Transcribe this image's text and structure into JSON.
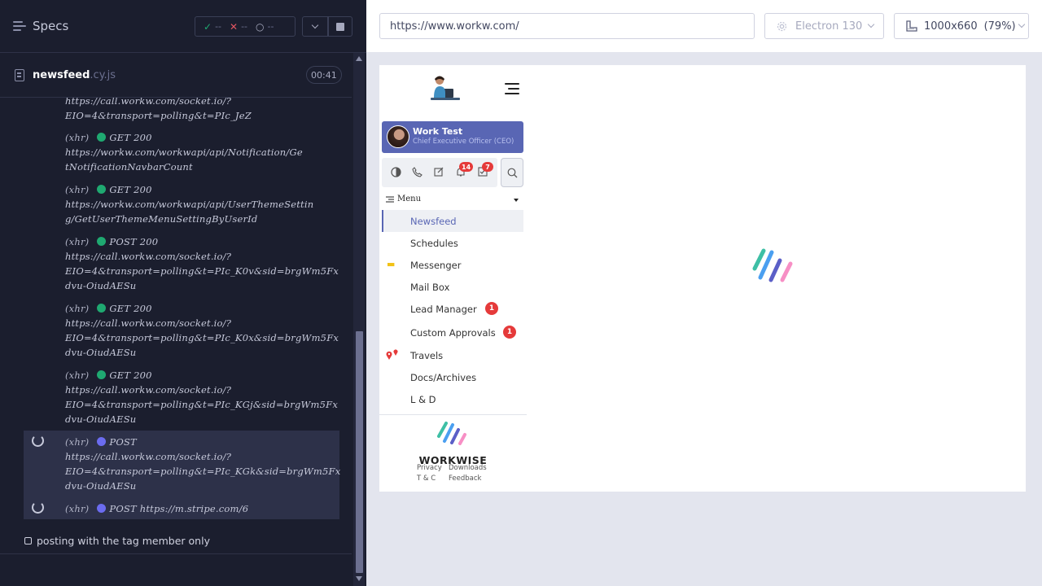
{
  "runner": {
    "header": {
      "title": "Specs"
    },
    "stats": {
      "passed": "--",
      "failed": "--",
      "pending": "--"
    },
    "spec_file": {
      "name": "newsfeed",
      "ext": ".cy.js",
      "duration": "00:41"
    },
    "logs": [
      {
        "line1": "https://call.workw.com/socket.io/?",
        "line2": "EIO=4&transport=polling&t=PIc_JeZ"
      },
      {
        "tag": "(xhr)",
        "status": "GET 200",
        "line1": "https://workw.com/workwapi/api/Notification/Ge",
        "line2": "tNotificationNavbarCount"
      },
      {
        "tag": "(xhr)",
        "status": "GET 200",
        "line1": "https://workw.com/workwapi/api/UserThemeSettin",
        "line2": "g/GetUserThemeMenuSettingByUserId"
      },
      {
        "tag": "(xhr)",
        "status": "POST 200",
        "line1": "https://call.workw.com/socket.io/?",
        "line2": "EIO=4&transport=polling&t=PIc_K0v&sid=brgWm5Fx",
        "line3": "dvu-OiudAESu"
      },
      {
        "tag": "(xhr)",
        "status": "GET 200",
        "line1": "https://call.workw.com/socket.io/?",
        "line2": "EIO=4&transport=polling&t=PIc_K0x&sid=brgWm5Fx",
        "line3": "dvu-OiudAESu"
      },
      {
        "tag": "(xhr)",
        "status": "GET 200",
        "line1": "https://call.workw.com/socket.io/?",
        "line2": "EIO=4&transport=polling&t=PIc_KGj&sid=brgWm5Fx",
        "line3": "dvu-OiudAESu"
      },
      {
        "tag": "(xhr)",
        "status": "POST",
        "line1": "https://call.workw.com/socket.io/?",
        "line2": "EIO=4&transport=polling&t=PIc_KGk&sid=brgWm5Fx",
        "line3": "dvu-OiudAESu"
      },
      {
        "tag": "(xhr)",
        "status": "POST https://m.stripe.com/6"
      }
    ],
    "test_name": "posting with the tag member only"
  },
  "browser": {
    "url": "https://www.workw.com/",
    "engine": "Electron 130",
    "viewport": "1000x660",
    "zoom": "(79%)"
  },
  "app": {
    "profile": {
      "name": "Work Test",
      "role": "Chief Executive Officer (CEO)"
    },
    "notif_badge": "14",
    "task_badge": "7",
    "menu_label": "Menu",
    "nav": [
      {
        "label": "Newsfeed"
      },
      {
        "label": "Schedules"
      },
      {
        "label": "Messenger"
      },
      {
        "label": "Mail Box"
      },
      {
        "label": "Lead Manager",
        "badge": "1"
      },
      {
        "label": "Custom Approvals",
        "badge": "1"
      },
      {
        "label": "Travels"
      },
      {
        "label": "Docs/Archives"
      },
      {
        "label": "L & D"
      }
    ],
    "brand": "WORKWISE",
    "footer_links": {
      "privacy": "Privacy",
      "downloads": "Downloads",
      "tc": "T & C",
      "feedback": "Feedback"
    },
    "colors": {
      "accent": "#5966b4",
      "badge": "#e53a3a",
      "loader": [
        "#3ebfa5",
        "#4a9ff0",
        "#5b5fc7",
        "#f78fc5"
      ]
    }
  }
}
